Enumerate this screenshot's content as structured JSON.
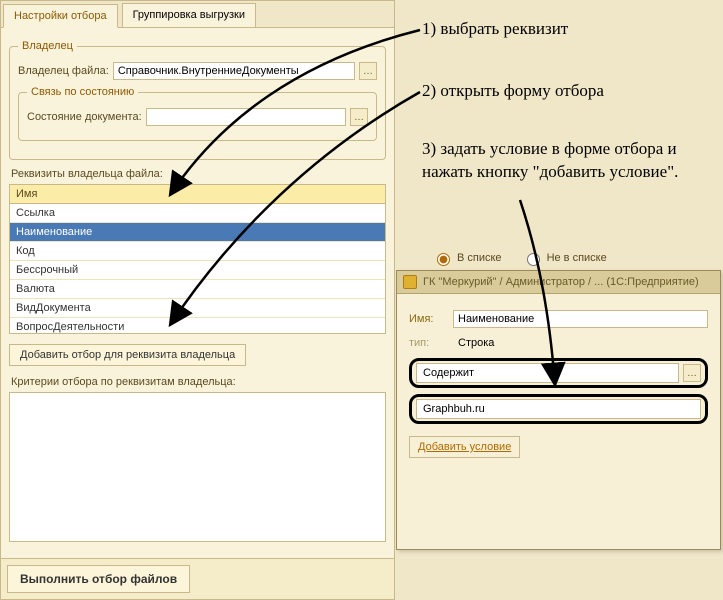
{
  "tabs": {
    "settings": "Настройки отбора",
    "grouping": "Группировка выгрузки"
  },
  "owner": {
    "groupTitle": "Владелец",
    "fileOwnerLabel": "Владелец файла:",
    "fileOwnerValue": "Справочник.ВнутренниеДокументы",
    "relationGroupTitle": "Связь по состоянию",
    "documentStateLabel": "Состояние документа:",
    "documentStateValue": ""
  },
  "requisitesLabel": "Реквизиты владельца файла:",
  "listHeader": "Имя",
  "requisites": [
    "Ссылка",
    "Наименование",
    "Код",
    "Бессрочный",
    "Валюта",
    "ВидДокумента",
    "ВопросДеятельности"
  ],
  "selectedIndex": 1,
  "addFilterBtn": "Добавить отбор для реквизита владельца",
  "criteriaLabel": "Критерии отбора по реквизитам владельца:",
  "runBtn": "Выполнить отбор файлов",
  "annotations": {
    "step1": "1) выбрать реквизит",
    "step2": "2) открыть форму отбора",
    "step3": "3) задать условие в форме отбора и нажать кнопку \"добавить условие\"."
  },
  "radio": {
    "inList": "В списке",
    "notInList": "Не в списке"
  },
  "miniWindow": {
    "title": "ГК \"Меркурий\" / Администратор / ... (1С:Предприятие)",
    "nameLabel": "Имя:",
    "nameValue": "Наименование",
    "typeLabel": "тип:",
    "typeValue": "Строка",
    "conditionValue": "Содержит",
    "patternValue": "Graphbuh.ru",
    "addConditionBtn": "Добавить условие"
  }
}
